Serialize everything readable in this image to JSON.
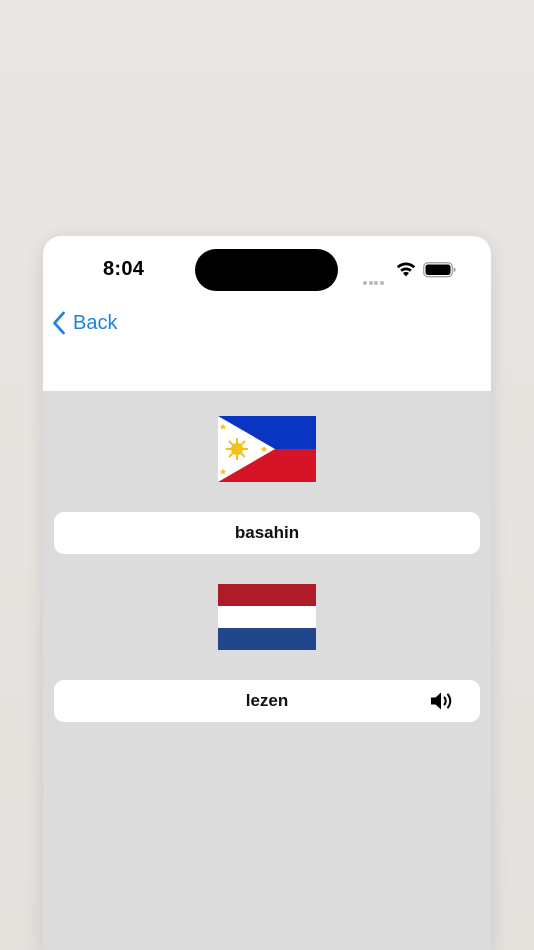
{
  "status_bar": {
    "time": "8:04",
    "icons": [
      "signal-dots-icon",
      "wifi-icon",
      "battery-icon"
    ]
  },
  "nav": {
    "back_label": "Back",
    "back_icon": "chevron-left-icon",
    "accent_color": "#1e82e0"
  },
  "cards": [
    {
      "flag": "philippines-flag",
      "word": "basahin"
    },
    {
      "flag": "netherlands-flag",
      "word": "lezen",
      "audio_icon": "speaker-icon"
    }
  ],
  "colors": {
    "content_background": "#dcdcdc",
    "card_background": "#ffffff"
  }
}
